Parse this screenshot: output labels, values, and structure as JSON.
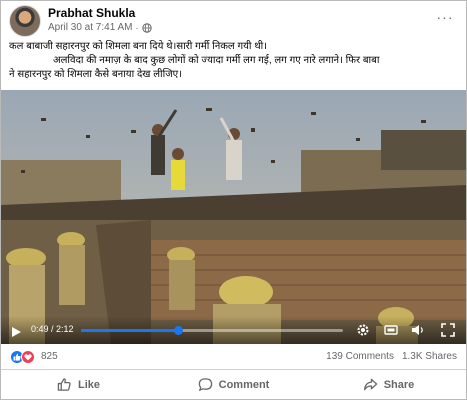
{
  "post": {
    "author": "Prabhat Shukla",
    "date": "April 30 at 7:41 AM",
    "separator": "·",
    "more_label": "···",
    "caption_line1": "कल बाबाजी सहारनपुर को शिमला बना दिये थे।सारी गर्मी निकल गयी थी।",
    "caption_line2": "अलविदा की नमाज़ के बाद कुछ लोगों को ज्यादा गर्मी लग गई, लग गए  नारे लगाने। फिर बाबा",
    "caption_line3": "ने सहारनपुर को शिमला कैसे बनाया देख लीजिए।"
  },
  "video": {
    "time": "0:49 / 2:12",
    "progress": 0.37,
    "icons": [
      "play-icon",
      "settings-icon",
      "hd-icon",
      "volume-icon",
      "fullscreen-icon"
    ]
  },
  "reactions": {
    "count": "825",
    "types": [
      "like",
      "love"
    ],
    "comments": "139 Comments",
    "shares": "1.3K Shares"
  },
  "actions": {
    "like": "Like",
    "comment": "Comment",
    "share": "Share"
  },
  "colors": {
    "accent": "#1877f2",
    "love": "#f33e58",
    "text_secondary": "#65676b"
  }
}
